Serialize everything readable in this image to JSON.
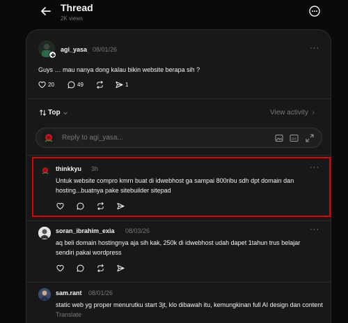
{
  "header": {
    "title": "Thread",
    "views": "2K views"
  },
  "post": {
    "username": "agi_yasa",
    "date": "08/01/26",
    "text": "Guys … mau nanya dong kalau bikin website berapa sih ?",
    "likes": "20",
    "comments": "49",
    "shares": "1"
  },
  "sort": {
    "label": "Top",
    "view_activity": "View activity"
  },
  "reply_box": {
    "placeholder": "Reply to agi_yasa..."
  },
  "replies": [
    {
      "username": "thinkkyu",
      "time": "3h",
      "text": "Untuk website compro kmrn buat di idwebhost ga sampai 800ribu sdh dpt domain dan hosting...buatnya pake sitebuilder sitepad"
    },
    {
      "username": "soran_ibrahim_exia",
      "time": "08/03/26",
      "text": "aq beli domain hostingnya aja sih kak, 250k di idwebhost udah dapet 1tahun trus belajar sendiri pakai wordpress"
    },
    {
      "username": "sam.rant",
      "time": "08/01/26",
      "text": "static web yg proper menurutku start 3jt, klo dibawah itu, kemungkinan full AI design dan content",
      "translate": "Translate"
    }
  ],
  "colors": {
    "highlight": "#e00000",
    "background": "#0a0a0a",
    "card": "#181818"
  }
}
